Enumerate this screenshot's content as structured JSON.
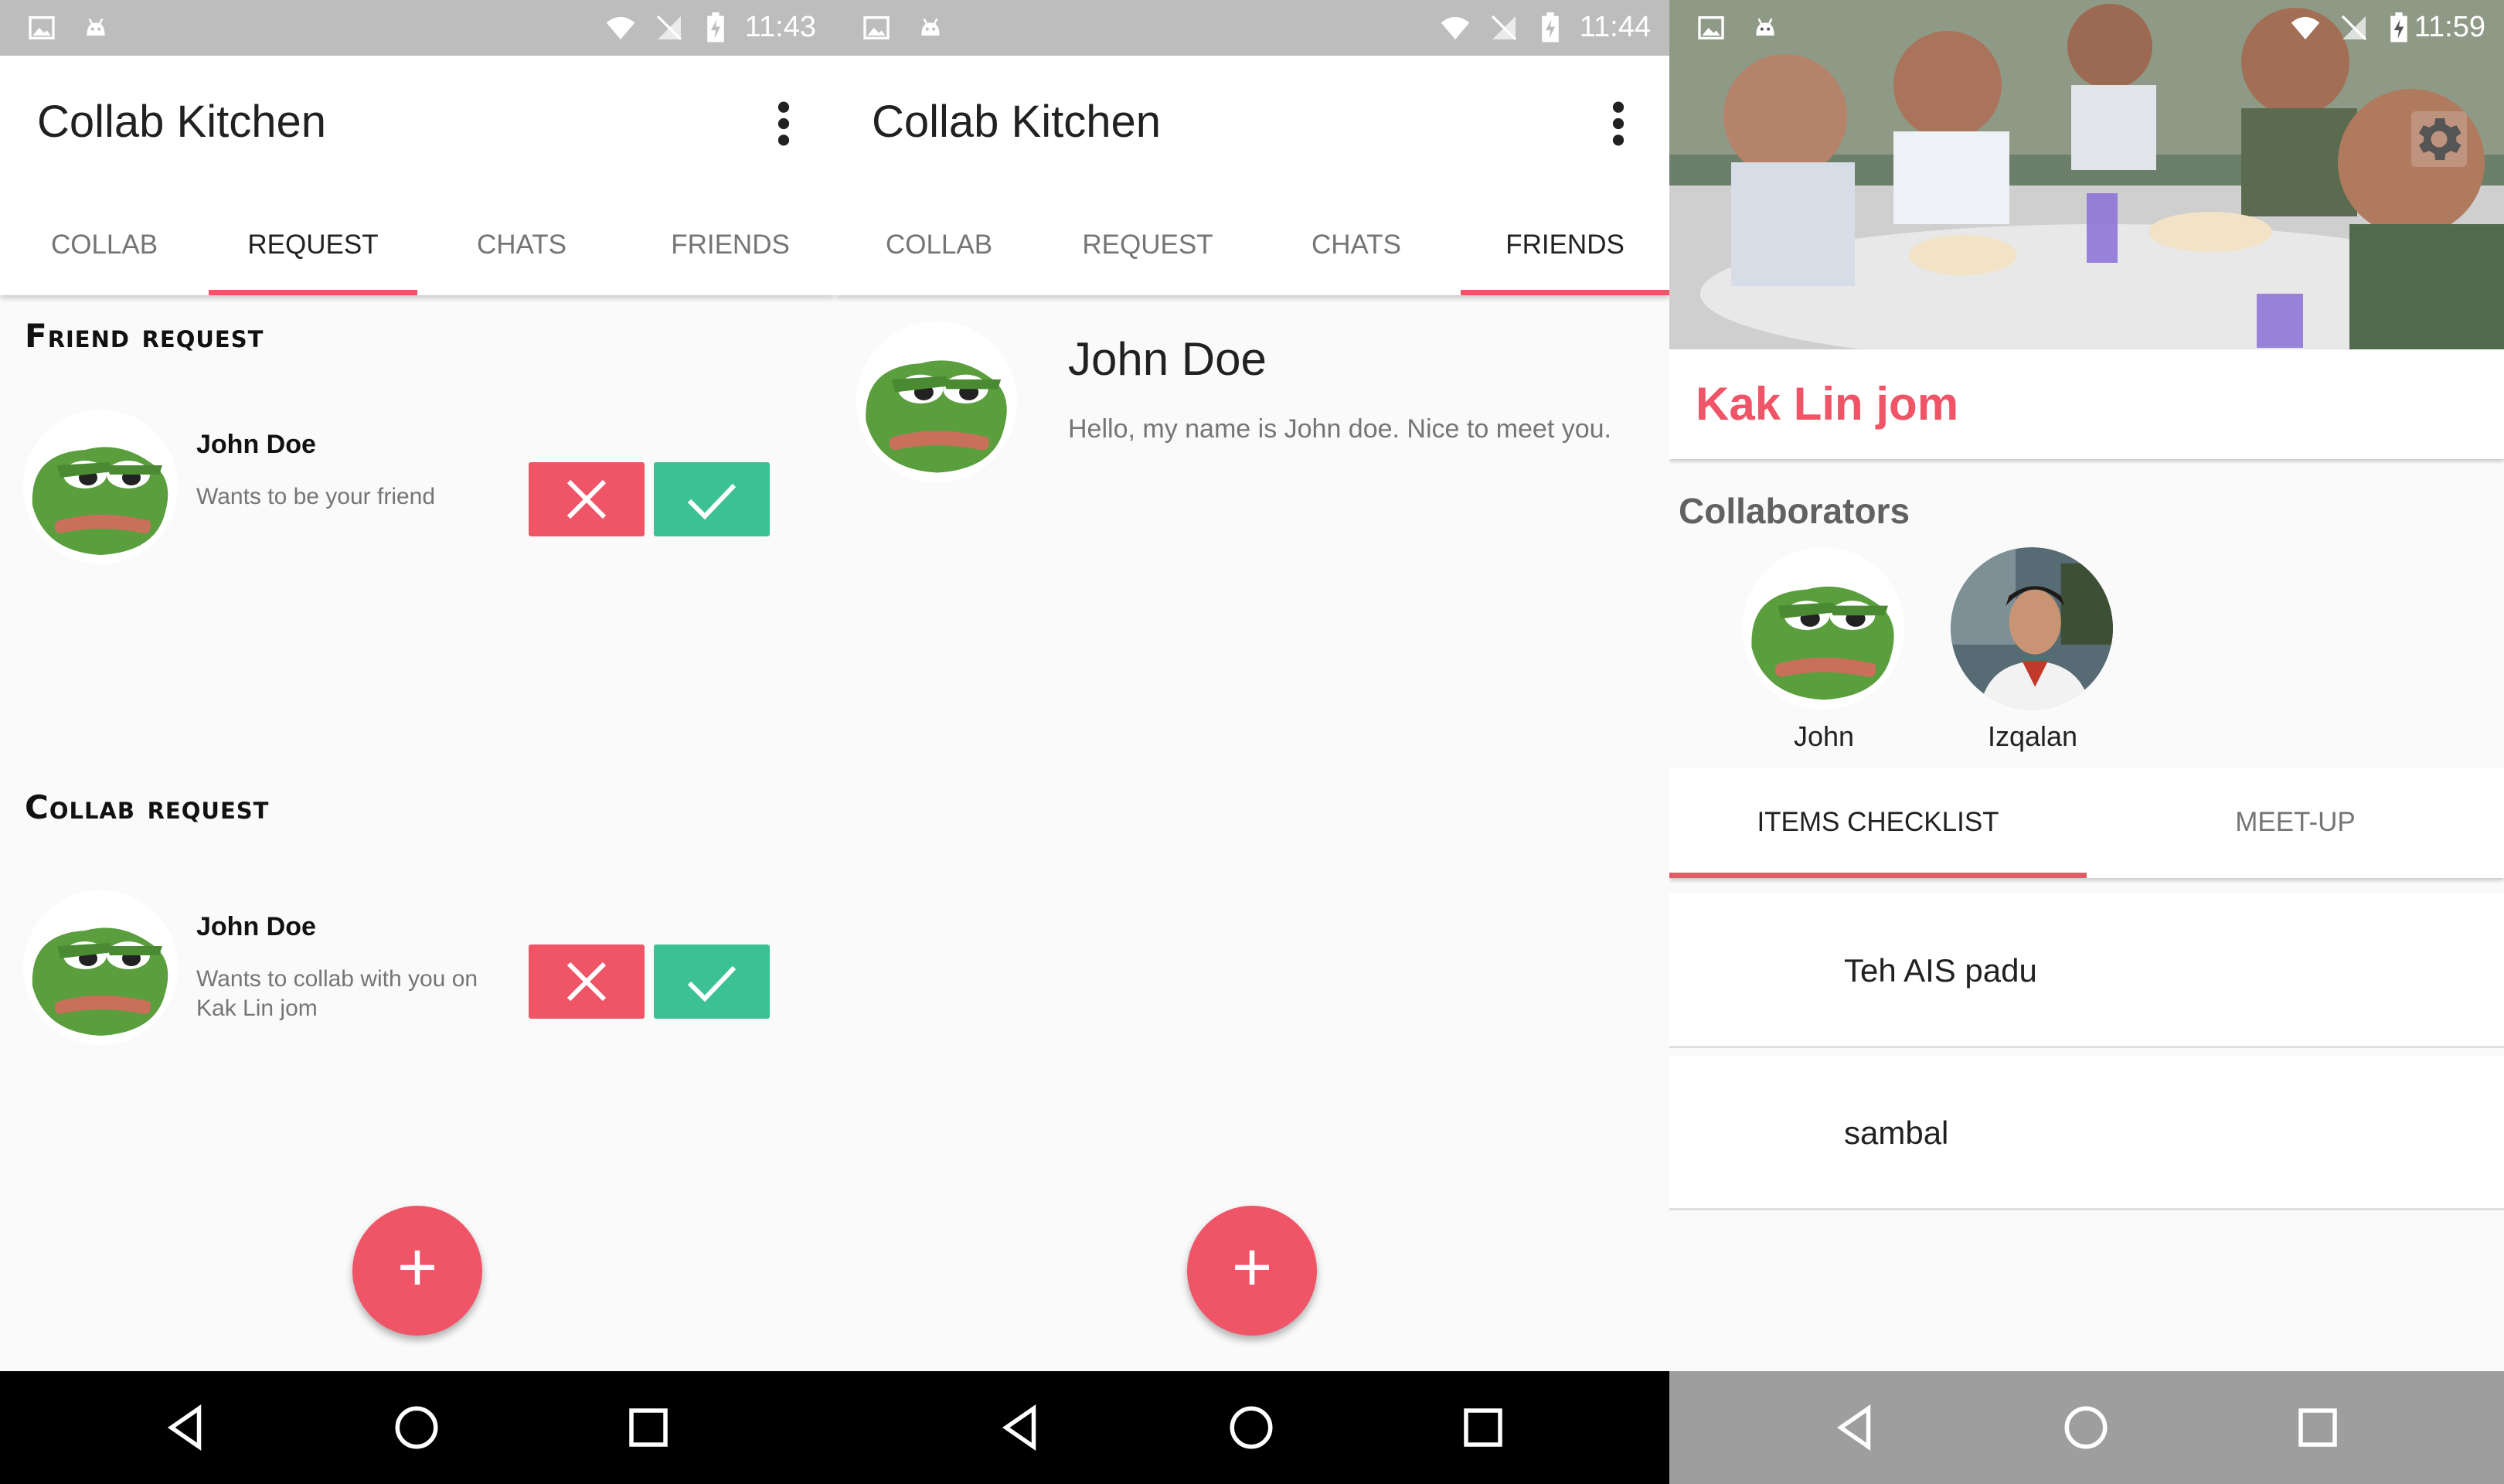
{
  "panels": [
    {
      "status": {
        "time": "11:43"
      },
      "app_title": "Collab Kitchen",
      "tabs": [
        "COLLAB",
        "REQUEST",
        "CHATS",
        "FRIENDS"
      ],
      "active_tab": "REQUEST",
      "friend_request": {
        "heading": "Friend request",
        "name": "John Doe",
        "message": "Wants to be your friend"
      },
      "collab_request": {
        "heading": "Collab request",
        "name": "John Doe",
        "message": "Wants to collab with you on Kak Lin jom"
      },
      "fab_label": "+"
    },
    {
      "status": {
        "time": "11:44"
      },
      "app_title": "Collab Kitchen",
      "tabs": [
        "COLLAB",
        "REQUEST",
        "CHATS",
        "FRIENDS"
      ],
      "active_tab": "FRIENDS",
      "friend": {
        "name": "John Doe",
        "bio": "Hello, my name is John doe. Nice to meet you."
      },
      "fab_label": "+"
    },
    {
      "status": {
        "time": "11:59"
      },
      "collab_title": "Kak Lin jom",
      "collaborators_label": "Collaborators",
      "collaborators": [
        "John",
        "Izqalan"
      ],
      "subtabs": [
        "ITEMS CHECKLIST",
        "MEET-UP"
      ],
      "active_subtab": "ITEMS CHECKLIST",
      "checklist": [
        "Teh AIS padu",
        "sambal"
      ]
    }
  ],
  "colors": {
    "accent": "#ef5467",
    "accept": "#3cc195",
    "statusbar": "#bdbdbd"
  },
  "icons": [
    "image-icon",
    "android-icon",
    "wifi-icon",
    "no-signal-icon",
    "battery-charging-icon",
    "more-vert-icon",
    "close-icon",
    "check-icon",
    "add-icon",
    "back-icon",
    "home-icon",
    "recents-icon",
    "settings-icon"
  ]
}
